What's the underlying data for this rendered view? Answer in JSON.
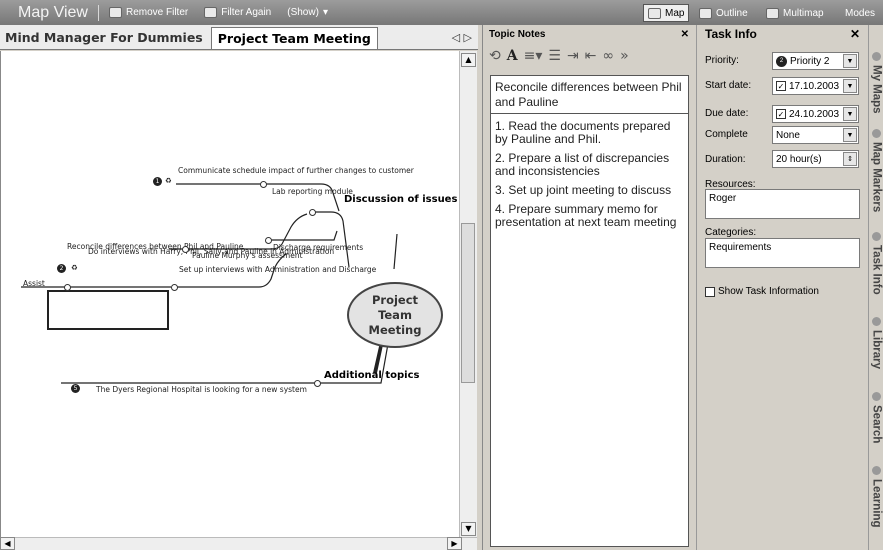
{
  "topbar": {
    "title": "Map View",
    "remove_filter": "Remove Filter",
    "filter_again": "Filter Again",
    "show": "(Show)",
    "map": "Map",
    "outline": "Outline",
    "multimap": "Multimap",
    "modes": "Modes"
  },
  "tabs": {
    "tab1": "Mind Manager For Dummies",
    "tab2": "Project Team Meeting",
    "arrows": "◁ ▷"
  },
  "map": {
    "central": "Project Team Meeting",
    "discussion": "Discussion of issues",
    "additional": "Additional topics",
    "communicate": "Communicate schedule impact of further changes to customer",
    "lab": "Lab reporting module",
    "reconcile": "Reconcile differences between Phil and Pauline",
    "pauline": "Pauline Murphy's assessment",
    "discharge": "Discharge requirements",
    "interviews": "Do interviews with Harry, Phil, Sally and Pauline in Administration",
    "setup": "Set up interviews with Administration and Discharge",
    "assist": "Assist",
    "dyers": "The Dyers Regional Hospital is looking for a new system",
    "badge1": "1",
    "badge2": "2",
    "badge5": "5"
  },
  "notes": {
    "header": "Topic Notes",
    "title": "Reconcile differences between Phil and Pauline",
    "items": [
      "1. Read the documents prepared by Pauline and Phil.",
      "2. Prepare a list of discrepancies and inconsistencies",
      "3. Set up joint meeting to discuss",
      "4. Prepare summary memo for presentation at next team meeting"
    ]
  },
  "task": {
    "header": "Task Info",
    "priority_label": "Priority:",
    "priority": "Priority 2",
    "start_label": "Start date:",
    "start": "17.10.2003",
    "due_label": "Due date:",
    "due": "24.10.2003",
    "complete_label": "Complete",
    "complete": "None",
    "duration_label": "Duration:",
    "duration": "20 hour(s)",
    "resources_label": "Resources:",
    "resources": "Roger",
    "categories_label": "Categories:",
    "categories": "Requirements",
    "show_info": "Show Task Information"
  },
  "dock": [
    "My Maps",
    "Map Markers",
    "Task Info",
    "Library",
    "Search",
    "Learning"
  ]
}
